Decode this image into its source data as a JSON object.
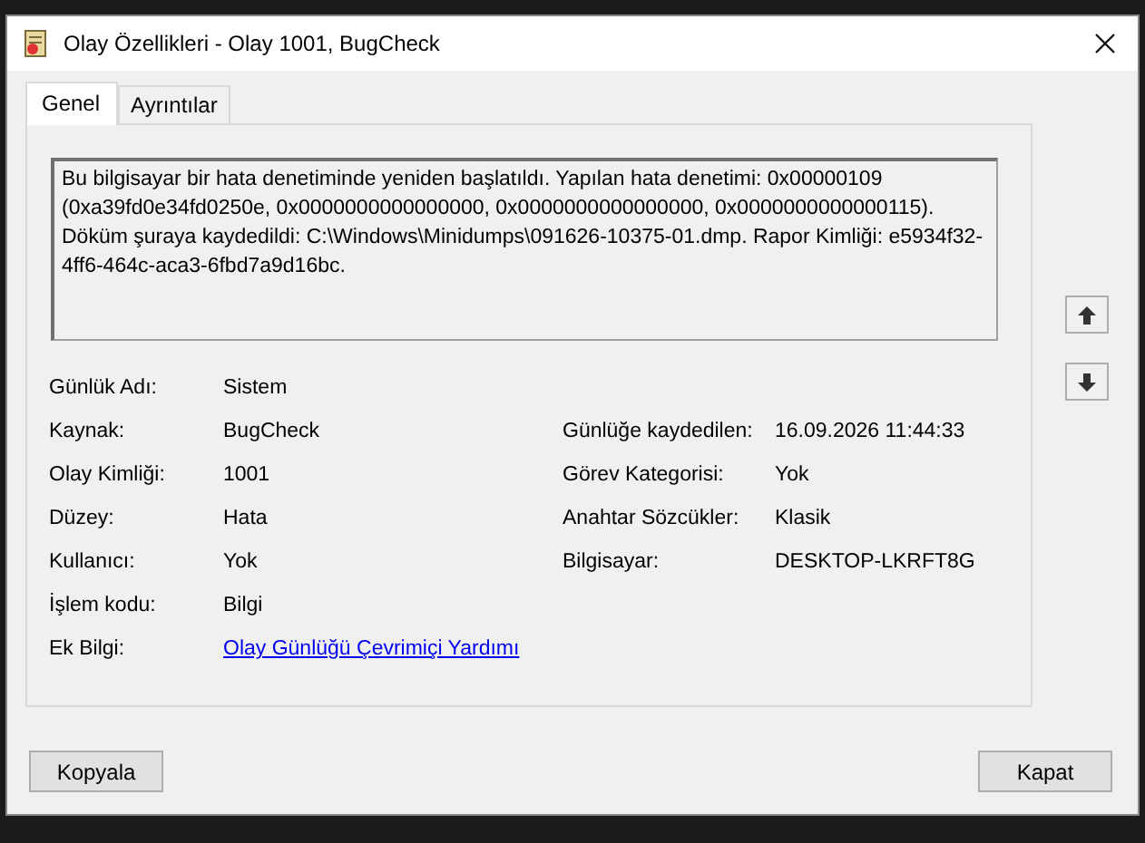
{
  "window": {
    "title": "Olay Özellikleri - Olay 1001, BugCheck"
  },
  "tabs": [
    {
      "label": "Genel",
      "selected": true
    },
    {
      "label": "Ayrıntılar",
      "selected": false
    }
  ],
  "description": "Bu bilgisayar bir hata denetiminde yeniden başlatıldı. Yapılan hata denetimi: 0x00000109 (0xa39fd0e34fd0250e, 0x0000000000000000, 0x0000000000000000, 0x0000000000000115). Döküm şuraya kaydedildi: C:\\Windows\\Minidumps\\091626-10375-01.dmp. Rapor Kimliği: e5934f32-4ff6-464c-aca3-6fbd7a9d16bc.",
  "rows": [
    {
      "left": {
        "label": "Günlük Adı:",
        "value": "Sistem"
      }
    },
    {
      "left": {
        "label": "Kaynak:",
        "value": "BugCheck"
      },
      "right": {
        "label": "Günlüğe kaydedilen:",
        "value": "16.09.2026 11:44:33"
      }
    },
    {
      "left": {
        "label": "Olay Kimliği:",
        "value": "1001"
      },
      "right": {
        "label": "Görev Kategorisi:",
        "value": "Yok"
      }
    },
    {
      "left": {
        "label": "Düzey:",
        "value": "Hata"
      },
      "right": {
        "label": "Anahtar Sözcükler:",
        "value": "Klasik"
      }
    },
    {
      "left": {
        "label": "Kullanıcı:",
        "value": "Yok"
      },
      "right": {
        "label": "Bilgisayar:",
        "value": "DESKTOP-LKRFT8G"
      }
    },
    {
      "left": {
        "label": "İşlem kodu:",
        "value": "Bilgi"
      }
    },
    {
      "left": {
        "label": "Ek Bilgi:",
        "value": "Olay Günlüğü Çevrimiçi Yardımı",
        "kind": "link"
      }
    }
  ],
  "buttons": [
    "Kopyala",
    "Kapat"
  ]
}
